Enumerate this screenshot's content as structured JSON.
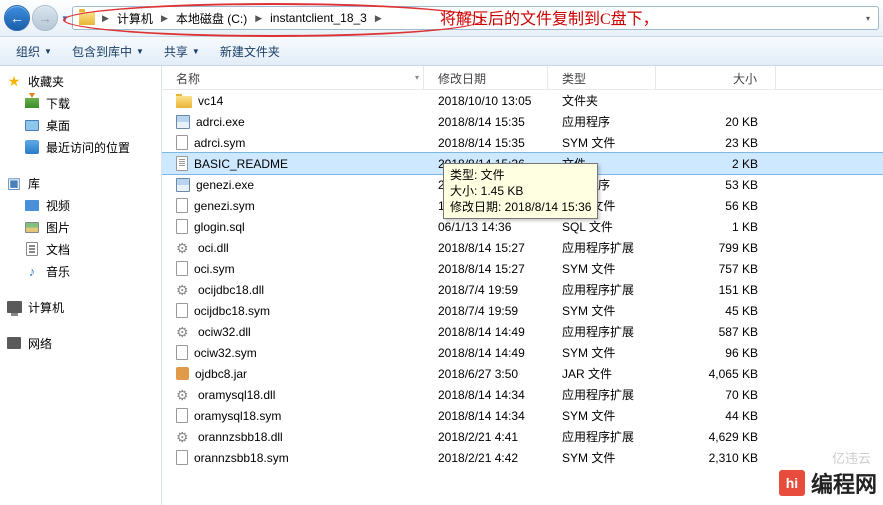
{
  "nav": {
    "back": "←",
    "fwd": "→"
  },
  "breadcrumbs": [
    "计算机",
    "本地磁盘 (C:)",
    "instantclient_18_3"
  ],
  "annotation": "将解压后的文件复制到C盘下，",
  "toolbar": {
    "org": "组织",
    "lib": "包含到库中",
    "share": "共享",
    "newf": "新建文件夹"
  },
  "sidebar": {
    "fav": {
      "head": "收藏夹",
      "items": [
        "下载",
        "桌面",
        "最近访问的位置"
      ]
    },
    "lib": {
      "head": "库",
      "items": [
        "视频",
        "图片",
        "文档",
        "音乐"
      ]
    },
    "comp": "计算机",
    "net": "网络"
  },
  "cols": {
    "name": "名称",
    "date": "修改日期",
    "type": "类型",
    "size": "大小"
  },
  "tooltip": {
    "l1": "类型: 文件",
    "l2": "大小: 1.45 KB",
    "l3": "修改日期: 2018/8/14 15:36"
  },
  "files": [
    {
      "ico": "folder",
      "name": "vc14",
      "date": "2018/10/10 13:05",
      "type": "文件夹",
      "size": ""
    },
    {
      "ico": "exe",
      "name": "adrci.exe",
      "date": "2018/8/14 15:35",
      "type": "应用程序",
      "size": "20 KB"
    },
    {
      "ico": "sym",
      "name": "adrci.sym",
      "date": "2018/8/14 15:35",
      "type": "SYM 文件",
      "size": "23 KB"
    },
    {
      "ico": "txt",
      "name": "BASIC_README",
      "date": "2018/8/14 15:36",
      "type": "文件",
      "size": "2 KB",
      "sel": true
    },
    {
      "ico": "exe",
      "name": "genezi.exe",
      "date": "2018/8/14 15:35",
      "type": "应用程序",
      "size": "53 KB"
    },
    {
      "ico": "sym",
      "name": "genezi.sym",
      "date": "18/8/14 15:35",
      "type": "SYM 文件",
      "size": "56 KB"
    },
    {
      "ico": "sql",
      "name": "glogin.sql",
      "date": "06/1/13 14:36",
      "type": "SQL 文件",
      "size": "1 KB"
    },
    {
      "ico": "dll",
      "name": "oci.dll",
      "date": "2018/8/14 15:27",
      "type": "应用程序扩展",
      "size": "799 KB"
    },
    {
      "ico": "sym",
      "name": "oci.sym",
      "date": "2018/8/14 15:27",
      "type": "SYM 文件",
      "size": "757 KB"
    },
    {
      "ico": "dll",
      "name": "ocijdbc18.dll",
      "date": "2018/7/4 19:59",
      "type": "应用程序扩展",
      "size": "151 KB"
    },
    {
      "ico": "sym",
      "name": "ocijdbc18.sym",
      "date": "2018/7/4 19:59",
      "type": "SYM 文件",
      "size": "45 KB"
    },
    {
      "ico": "dll",
      "name": "ociw32.dll",
      "date": "2018/8/14 14:49",
      "type": "应用程序扩展",
      "size": "587 KB"
    },
    {
      "ico": "sym",
      "name": "ociw32.sym",
      "date": "2018/8/14 14:49",
      "type": "SYM 文件",
      "size": "96 KB"
    },
    {
      "ico": "jar",
      "name": "ojdbc8.jar",
      "date": "2018/6/27 3:50",
      "type": "JAR 文件",
      "size": "4,065 KB"
    },
    {
      "ico": "dll",
      "name": "oramysql18.dll",
      "date": "2018/8/14 14:34",
      "type": "应用程序扩展",
      "size": "70 KB"
    },
    {
      "ico": "sym",
      "name": "oramysql18.sym",
      "date": "2018/8/14 14:34",
      "type": "SYM 文件",
      "size": "44 KB"
    },
    {
      "ico": "dll",
      "name": "orannzsbb18.dll",
      "date": "2018/2/21 4:41",
      "type": "应用程序扩展",
      "size": "4,629 KB"
    },
    {
      "ico": "sym",
      "name": "orannzsbb18.sym",
      "date": "2018/2/21 4:42",
      "type": "SYM 文件",
      "size": "2,310 KB"
    }
  ],
  "watermark": {
    "logo": "hi",
    "text": "编程网"
  },
  "corner": "亿违云"
}
